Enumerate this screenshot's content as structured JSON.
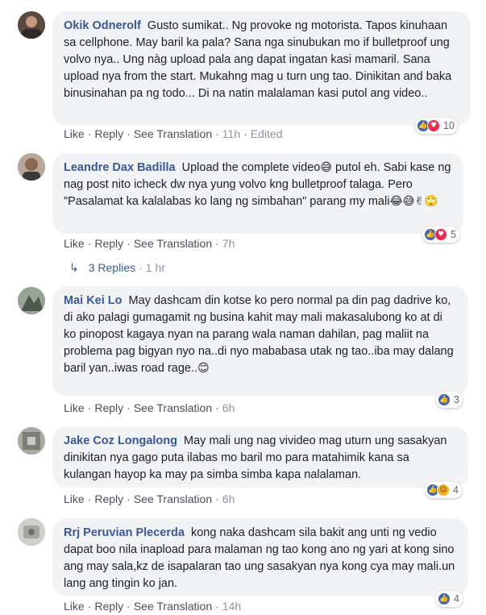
{
  "comments": [
    {
      "author": "Okik Odnerolf",
      "text": "Gusto sumikat.. Ng provoke ng motorista. Tapos kinuhaan sa cellphone. May baril ka pala? Sana nga sinubukan mo if bulletproof ung volvo nya.. Ung nàg upload pala ang dapat ingatan kasi mamaril. Sana upload nya from the start. Mukahng mag u turn ung tao. Dinikitan and baka binusinahan pa ng todo... Di na natin malalaman kasi putol ang video..",
      "like": "Like",
      "reply": "Reply",
      "translate": "See Translation",
      "time": "11h",
      "edited": "Edited",
      "reaction_count": "10"
    },
    {
      "author": "Leandre Dax Badilla",
      "text_a": "Upload the complete video",
      "emoji_a": "😅",
      "text_b": " putol eh. Sabi kase ng nag post nito icheck dw nya yung volvo kng bulletproof talaga. Pero \"Pasalamat ka kalalabas ko lang ng simbahan\" parang my mali",
      "emoji_b": "😂😅✌🙄",
      "like": "Like",
      "reply": "Reply",
      "translate": "See Translation",
      "time": "7h",
      "reaction_count": "5"
    },
    {
      "author": "Mai Kei Lo",
      "text": "May dashcam din kotse ko pero normal pa din pag dadrive ko, di ako palagi gumagamit ng busina kahit may mali makasalubong ko at di ko pinopost kagaya nyan na parang wala naman dahilan, pag maliit na problema pag bigyan nyo na..di nyo mababasa utak ng tao..iba may dalang baril yan..iwas road rage..",
      "emoji": "😊",
      "like": "Like",
      "reply": "Reply",
      "translate": "See Translation",
      "time": "6h",
      "reaction_count": "3"
    },
    {
      "author": "Jake Coz Longalong",
      "text": "May mali ung nag vivideo mag uturn ung sasakyan dinikitan nya gago puta ilabas mo baril mo para matahimik kana sa kulangan hayop ka may pa simba simba kapa nalalaman.",
      "like": "Like",
      "reply": "Reply",
      "translate": "See Translation",
      "time": "6h",
      "reaction_count": "4"
    },
    {
      "author": "Rrj Peruvian Plecerda",
      "text": "kong naka dashcam sila bakit ang unti ng vedio dapat boo nila inapload para malaman ng tao kong ano ng yari at kong sino ang may sala,kz de isapalaran tao ung sasakyan nya kong cya may mali.un lang ang tingin ko jan.",
      "like": "Like",
      "reply": "Reply",
      "translate": "See Translation",
      "time": "14h",
      "reaction_count": "4"
    }
  ],
  "replies_link": {
    "label": "3 Replies",
    "time": "1 hr"
  },
  "colors": {
    "link": "#385898",
    "bubble": "#f2f3f5",
    "like": "#4267b2",
    "love": "#f0284a",
    "haha": "#f7b125"
  },
  "icons": [
    "like-icon",
    "love-icon",
    "haha-icon",
    "reply-arrow-icon"
  ]
}
